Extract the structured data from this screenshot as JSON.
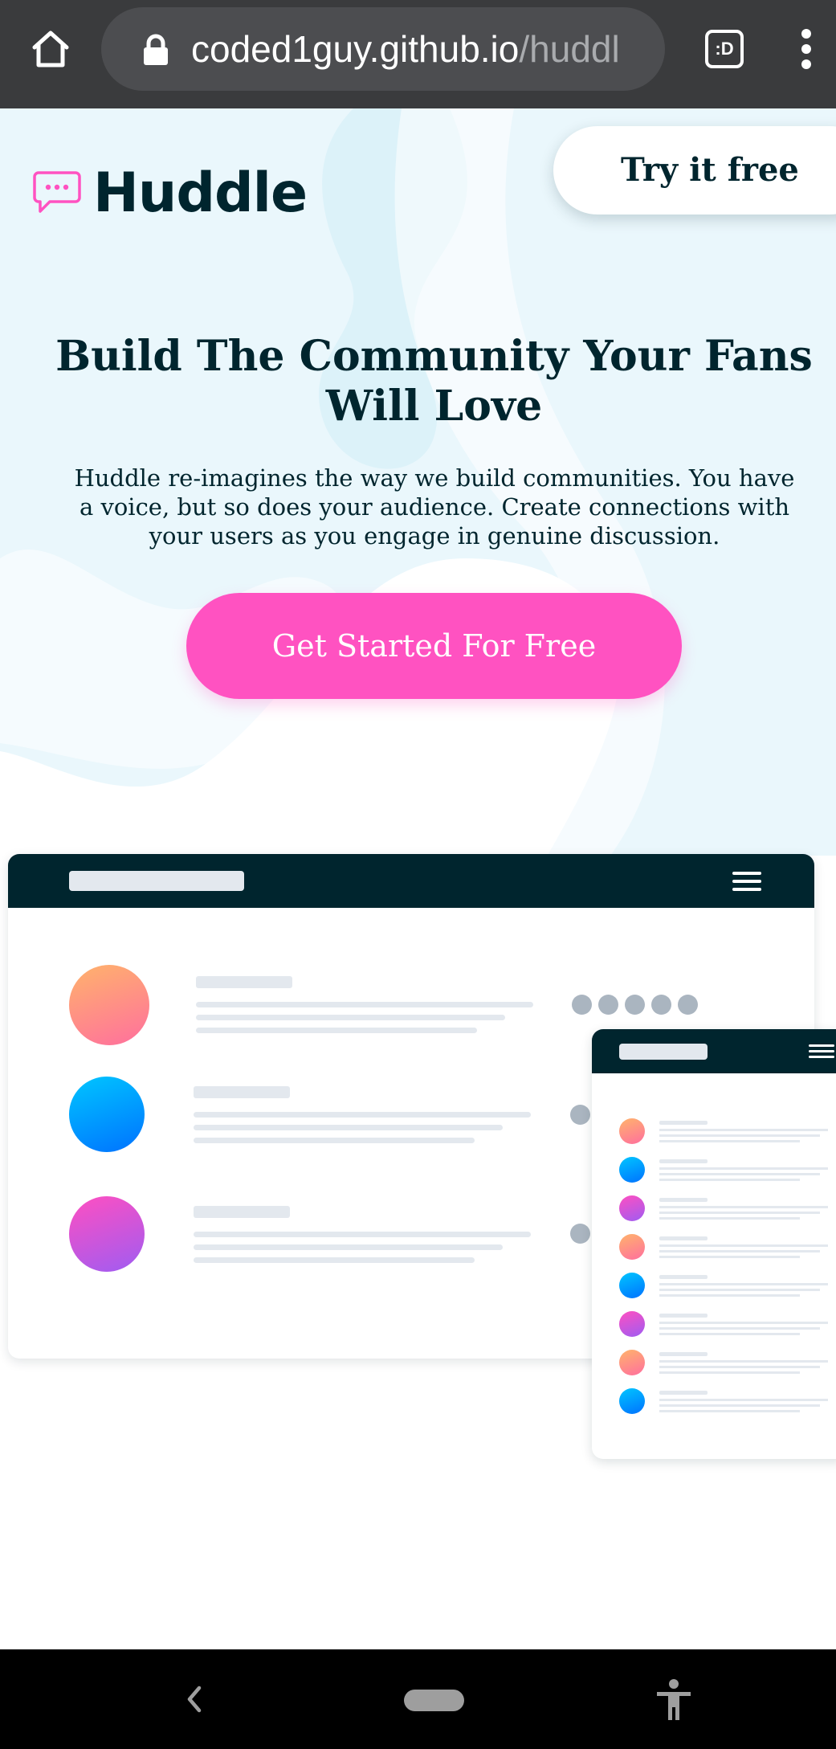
{
  "browser": {
    "url_host": "coded1guy.github.io",
    "url_path": "/huddl",
    "tabs_label": ":D"
  },
  "header": {
    "logo_text": "Huddle",
    "try_button": "Try it free"
  },
  "hero": {
    "title": "Build The Community Your Fans Will Love",
    "description": "Huddle re-imagines the way we build communities. You have a voice, but so does your audience. Create connections with your users as you engage in genuine discussion.",
    "cta": "Get Started For Free"
  },
  "colors": {
    "brand_dark": "#00252e",
    "accent_pink": "#ff52c1",
    "hero_tint": "#dff4fb"
  }
}
